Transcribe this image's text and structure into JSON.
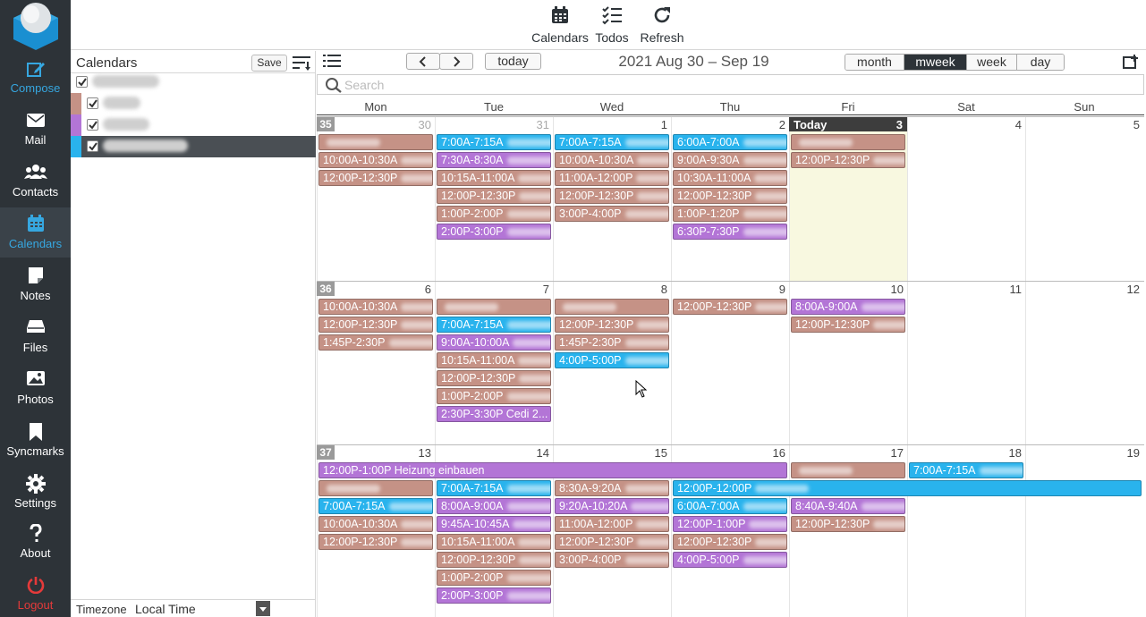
{
  "nav": {
    "items": [
      {
        "label": "Compose",
        "icon": "compose-icon"
      },
      {
        "label": "Mail",
        "icon": "mail-icon"
      },
      {
        "label": "Contacts",
        "icon": "contacts-icon"
      },
      {
        "label": "Calendars",
        "icon": "calendar-icon"
      },
      {
        "label": "Notes",
        "icon": "notes-icon"
      },
      {
        "label": "Files",
        "icon": "files-icon"
      },
      {
        "label": "Photos",
        "icon": "photos-icon"
      },
      {
        "label": "Syncmarks",
        "icon": "bookmark-icon"
      },
      {
        "label": "Settings",
        "icon": "gear-icon"
      },
      {
        "label": "About",
        "icon": "question-icon"
      },
      {
        "label": "Logout",
        "icon": "power-icon"
      }
    ],
    "active": "Calendars"
  },
  "toolbar": {
    "calendars": "Calendars",
    "todos": "Todos",
    "refresh": "Refresh"
  },
  "sidebar": {
    "title": "Calendars",
    "save": "Save",
    "calendars": [
      {
        "color": "#ffffff",
        "checked": true,
        "name": "(redacted)"
      },
      {
        "color": "#c59286",
        "checked": true,
        "name": "(redacted)"
      },
      {
        "color": "#b375d6",
        "checked": true,
        "name": "(redacted)"
      },
      {
        "color": "#29b3ed",
        "checked": true,
        "name": "(redacted)",
        "selected": true
      }
    ],
    "timezone_label": "Timezone",
    "timezone_value": "Local Time"
  },
  "calendar": {
    "today_button": "today",
    "range": "2021 Aug 30 – Sep 19",
    "views": [
      "month",
      "mweek",
      "week",
      "day"
    ],
    "active_view": "mweek",
    "search_placeholder": "Search",
    "weekdays": [
      "Mon",
      "Tue",
      "Wed",
      "Thu",
      "Fri",
      "Sat",
      "Sun"
    ],
    "today_label": "Today",
    "weeks": [
      {
        "num": "35",
        "days": [
          "30",
          "31",
          "1",
          "2",
          "3",
          "4",
          "5"
        ],
        "muted": [
          true,
          true,
          false,
          false,
          false,
          false,
          false
        ],
        "today_index": 4
      },
      {
        "num": "36",
        "days": [
          "6",
          "7",
          "8",
          "9",
          "10",
          "11",
          "12"
        ],
        "muted": [
          false,
          false,
          false,
          false,
          false,
          false,
          false
        ],
        "today_index": -1
      },
      {
        "num": "37",
        "days": [
          "13",
          "14",
          "15",
          "16",
          "17",
          "18",
          "19"
        ],
        "muted": [
          false,
          false,
          false,
          false,
          false,
          false,
          false
        ],
        "today_index": -1
      }
    ],
    "events": [
      {
        "week": 0,
        "day": 0,
        "slot": 0,
        "span": 1,
        "color": "brown",
        "text": "",
        "redacted": true
      },
      {
        "week": 0,
        "day": 0,
        "slot": 1,
        "span": 1,
        "color": "brown",
        "text": "10:00A-10:30A",
        "redacted": true
      },
      {
        "week": 0,
        "day": 0,
        "slot": 2,
        "span": 1,
        "color": "brown",
        "text": "12:00P-12:30P",
        "redacted": true
      },
      {
        "week": 0,
        "day": 1,
        "slot": 0,
        "span": 1,
        "color": "blue",
        "text": "7:00A-7:15A",
        "redacted": true
      },
      {
        "week": 0,
        "day": 1,
        "slot": 1,
        "span": 1,
        "color": "purple",
        "text": "7:30A-8:30A",
        "redacted": true
      },
      {
        "week": 0,
        "day": 1,
        "slot": 2,
        "span": 1,
        "color": "brown",
        "text": "10:15A-11:00A",
        "redacted": true
      },
      {
        "week": 0,
        "day": 1,
        "slot": 3,
        "span": 1,
        "color": "brown",
        "text": "12:00P-12:30P",
        "redacted": true
      },
      {
        "week": 0,
        "day": 1,
        "slot": 4,
        "span": 1,
        "color": "brown",
        "text": "1:00P-2:00P",
        "redacted": true
      },
      {
        "week": 0,
        "day": 1,
        "slot": 5,
        "span": 1,
        "color": "purple",
        "text": "2:00P-3:00P",
        "redacted": true
      },
      {
        "week": 0,
        "day": 2,
        "slot": 0,
        "span": 1,
        "color": "blue",
        "text": "7:00A-7:15A",
        "redacted": true
      },
      {
        "week": 0,
        "day": 2,
        "slot": 1,
        "span": 1,
        "color": "brown",
        "text": "10:00A-10:30A",
        "redacted": true
      },
      {
        "week": 0,
        "day": 2,
        "slot": 2,
        "span": 1,
        "color": "brown",
        "text": "11:00A-12:00P",
        "redacted": true
      },
      {
        "week": 0,
        "day": 2,
        "slot": 3,
        "span": 1,
        "color": "brown",
        "text": "12:00P-12:30P",
        "redacted": true
      },
      {
        "week": 0,
        "day": 2,
        "slot": 4,
        "span": 1,
        "color": "brown",
        "text": "3:00P-4:00P",
        "redacted": true
      },
      {
        "week": 0,
        "day": 3,
        "slot": 0,
        "span": 1,
        "color": "blue",
        "text": "6:00A-7:00A",
        "redacted": true
      },
      {
        "week": 0,
        "day": 3,
        "slot": 1,
        "span": 1,
        "color": "brown",
        "text": "9:00A-9:30A",
        "redacted": true
      },
      {
        "week": 0,
        "day": 3,
        "slot": 2,
        "span": 1,
        "color": "brown",
        "text": "10:30A-11:00A",
        "redacted": true
      },
      {
        "week": 0,
        "day": 3,
        "slot": 3,
        "span": 1,
        "color": "brown",
        "text": "12:00P-12:30P",
        "redacted": true
      },
      {
        "week": 0,
        "day": 3,
        "slot": 4,
        "span": 1,
        "color": "brown",
        "text": "1:00P-1:20P",
        "redacted": true
      },
      {
        "week": 0,
        "day": 3,
        "slot": 5,
        "span": 1,
        "color": "purple",
        "text": "6:30P-7:30P",
        "redacted": true
      },
      {
        "week": 0,
        "day": 4,
        "slot": 0,
        "span": 1,
        "color": "brown",
        "text": "",
        "redacted": true
      },
      {
        "week": 0,
        "day": 4,
        "slot": 1,
        "span": 1,
        "color": "brown",
        "text": "12:00P-12:30P",
        "redacted": true
      },
      {
        "week": 1,
        "day": 0,
        "slot": 0,
        "span": 1,
        "color": "brown",
        "text": "10:00A-10:30A",
        "redacted": true
      },
      {
        "week": 1,
        "day": 0,
        "slot": 1,
        "span": 1,
        "color": "brown",
        "text": "12:00P-12:30P",
        "redacted": true
      },
      {
        "week": 1,
        "day": 0,
        "slot": 2,
        "span": 1,
        "color": "brown",
        "text": "1:45P-2:30P",
        "redacted": true
      },
      {
        "week": 1,
        "day": 1,
        "slot": 0,
        "span": 1,
        "color": "brown",
        "text": "",
        "redacted": true
      },
      {
        "week": 1,
        "day": 1,
        "slot": 1,
        "span": 1,
        "color": "blue",
        "text": "7:00A-7:15A",
        "redacted": true
      },
      {
        "week": 1,
        "day": 1,
        "slot": 2,
        "span": 1,
        "color": "purple",
        "text": "9:00A-10:00A",
        "redacted": true
      },
      {
        "week": 1,
        "day": 1,
        "slot": 3,
        "span": 1,
        "color": "brown",
        "text": "10:15A-11:00A",
        "redacted": true
      },
      {
        "week": 1,
        "day": 1,
        "slot": 4,
        "span": 1,
        "color": "brown",
        "text": "12:00P-12:30P",
        "redacted": true
      },
      {
        "week": 1,
        "day": 1,
        "slot": 5,
        "span": 1,
        "color": "brown",
        "text": "1:00P-2:00P",
        "redacted": true
      },
      {
        "week": 1,
        "day": 1,
        "slot": 6,
        "span": 1,
        "color": "purple",
        "text": "2:30P-3:30P Cedi 2...",
        "redacted": false
      },
      {
        "week": 1,
        "day": 2,
        "slot": 0,
        "span": 1,
        "color": "brown",
        "text": "",
        "redacted": true
      },
      {
        "week": 1,
        "day": 2,
        "slot": 1,
        "span": 1,
        "color": "brown",
        "text": "12:00P-12:30P",
        "redacted": true
      },
      {
        "week": 1,
        "day": 2,
        "slot": 2,
        "span": 1,
        "color": "brown",
        "text": "1:45P-2:30P",
        "redacted": true
      },
      {
        "week": 1,
        "day": 2,
        "slot": 3,
        "span": 1,
        "color": "blue",
        "text": "4:00P-5:00P",
        "redacted": true
      },
      {
        "week": 1,
        "day": 3,
        "slot": 0,
        "span": 1,
        "color": "brown",
        "text": "12:00P-12:30P",
        "redacted": true
      },
      {
        "week": 1,
        "day": 4,
        "slot": 0,
        "span": 1,
        "color": "purple",
        "text": "8:00A-9:00A",
        "redacted": true
      },
      {
        "week": 1,
        "day": 4,
        "slot": 1,
        "span": 1,
        "color": "brown",
        "text": "12:00P-12:30P",
        "redacted": true
      },
      {
        "week": 2,
        "day": 0,
        "slot": 0,
        "span": 4,
        "color": "purple",
        "text": "12:00P-1:00P Heizung einbauen",
        "redacted": false
      },
      {
        "week": 2,
        "day": 4,
        "slot": 0,
        "span": 1,
        "color": "brown",
        "text": "",
        "redacted": true
      },
      {
        "week": 2,
        "day": 5,
        "slot": 0,
        "span": 1,
        "color": "blue",
        "text": "7:00A-7:15A",
        "redacted": true
      },
      {
        "week": 2,
        "day": 0,
        "slot": 1,
        "span": 1,
        "color": "brown",
        "text": "",
        "redacted": true
      },
      {
        "week": 2,
        "day": 1,
        "slot": 1,
        "span": 1,
        "color": "blue",
        "text": "7:00A-7:15A",
        "redacted": true
      },
      {
        "week": 2,
        "day": 2,
        "slot": 1,
        "span": 1,
        "color": "brown",
        "text": "8:30A-9:20A",
        "redacted": true
      },
      {
        "week": 2,
        "day": 3,
        "slot": 1,
        "span": 4,
        "color": "blue",
        "text": "12:00P-12:00P",
        "redacted": true
      },
      {
        "week": 2,
        "day": 0,
        "slot": 2,
        "span": 1,
        "color": "blue",
        "text": "7:00A-7:15A",
        "redacted": true
      },
      {
        "week": 2,
        "day": 1,
        "slot": 2,
        "span": 1,
        "color": "purple",
        "text": "8:00A-9:00A",
        "redacted": true
      },
      {
        "week": 2,
        "day": 2,
        "slot": 2,
        "span": 1,
        "color": "purple",
        "text": "9:20A-10:20A",
        "redacted": true
      },
      {
        "week": 2,
        "day": 3,
        "slot": 2,
        "span": 1,
        "color": "blue",
        "text": "6:00A-7:00A",
        "redacted": true
      },
      {
        "week": 2,
        "day": 4,
        "slot": 2,
        "span": 1,
        "color": "purple",
        "text": "8:40A-9:40A",
        "redacted": true
      },
      {
        "week": 2,
        "day": 0,
        "slot": 3,
        "span": 1,
        "color": "brown",
        "text": "10:00A-10:30A",
        "redacted": true
      },
      {
        "week": 2,
        "day": 1,
        "slot": 3,
        "span": 1,
        "color": "purple",
        "text": "9:45A-10:45A",
        "redacted": true
      },
      {
        "week": 2,
        "day": 2,
        "slot": 3,
        "span": 1,
        "color": "brown",
        "text": "11:00A-12:00P",
        "redacted": true
      },
      {
        "week": 2,
        "day": 3,
        "slot": 3,
        "span": 1,
        "color": "purple",
        "text": "12:00P-1:00P",
        "redacted": true
      },
      {
        "week": 2,
        "day": 4,
        "slot": 3,
        "span": 1,
        "color": "brown",
        "text": "12:00P-12:30P",
        "redacted": true
      },
      {
        "week": 2,
        "day": 0,
        "slot": 4,
        "span": 1,
        "color": "brown",
        "text": "12:00P-12:30P",
        "redacted": true
      },
      {
        "week": 2,
        "day": 1,
        "slot": 4,
        "span": 1,
        "color": "brown",
        "text": "10:15A-11:00A",
        "redacted": true
      },
      {
        "week": 2,
        "day": 2,
        "slot": 4,
        "span": 1,
        "color": "brown",
        "text": "12:00P-12:30P",
        "redacted": true
      },
      {
        "week": 2,
        "day": 3,
        "slot": 4,
        "span": 1,
        "color": "brown",
        "text": "12:00P-12:30P",
        "redacted": true
      },
      {
        "week": 2,
        "day": 1,
        "slot": 5,
        "span": 1,
        "color": "brown",
        "text": "12:00P-12:30P",
        "redacted": true
      },
      {
        "week": 2,
        "day": 2,
        "slot": 5,
        "span": 1,
        "color": "brown",
        "text": "3:00P-4:00P",
        "redacted": true
      },
      {
        "week": 2,
        "day": 3,
        "slot": 5,
        "span": 1,
        "color": "purple",
        "text": "4:00P-5:00P",
        "redacted": true
      },
      {
        "week": 2,
        "day": 1,
        "slot": 6,
        "span": 1,
        "color": "brown",
        "text": "1:00P-2:00P",
        "redacted": true
      },
      {
        "week": 2,
        "day": 1,
        "slot": 7,
        "span": 1,
        "color": "purple",
        "text": "2:00P-3:00P",
        "redacted": true
      }
    ]
  },
  "colors": {
    "nav_bg": "#2d3338",
    "accent": "#36a7e0",
    "event_brown": "#c59286",
    "event_blue": "#29b3ed",
    "event_purple": "#b375d6",
    "today_bg": "#f8f8e0"
  }
}
